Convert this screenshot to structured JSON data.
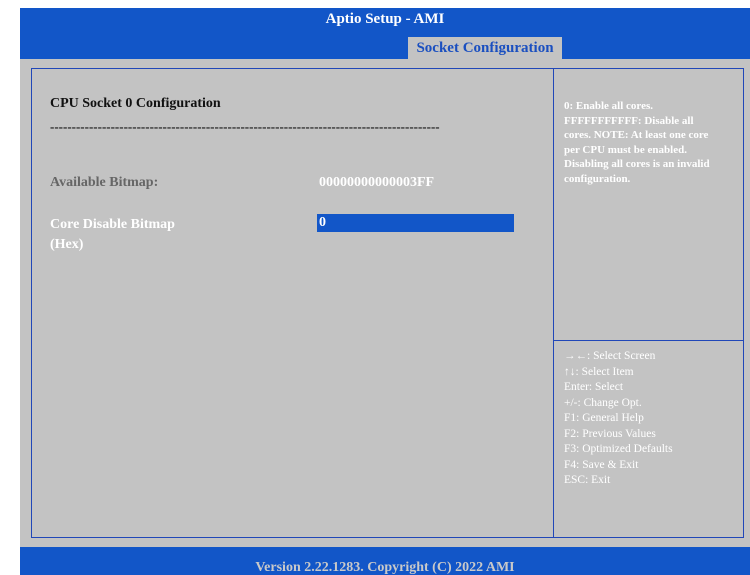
{
  "app": {
    "title": "Aptio Setup - AMI"
  },
  "tabs": [
    {
      "label": "Socket Configuration",
      "active": true
    }
  ],
  "main": {
    "section_title": "CPU Socket 0 Configuration",
    "separator": "------------------------------------------------------------------------------------------",
    "available_bitmap": {
      "label": "Available Bitmap:",
      "value": "00000000000003FF"
    },
    "core_disable": {
      "label": "Core Disable Bitmap (Hex)",
      "value": "0"
    }
  },
  "help": {
    "text": "0: Enable all cores. FFFFFFFFFFF: Disable all cores. NOTE: At least one core per CPU must be enabled. Disabling all cores is an invalid configuration."
  },
  "keys": [
    "→←: Select Screen",
    "↑↓: Select Item",
    "Enter: Select",
    "+/-: Change Opt.",
    "F1: General Help",
    "F2: Previous Values",
    "F3: Optimized Defaults",
    "F4: Save & Exit",
    "ESC: Exit"
  ],
  "footer": {
    "text": "Version 2.22.1283. Copyright (C) 2022 AMI"
  },
  "colors": {
    "blue": "#1256c8",
    "panel": "#c3c3c3",
    "frame": "#2147b8"
  }
}
